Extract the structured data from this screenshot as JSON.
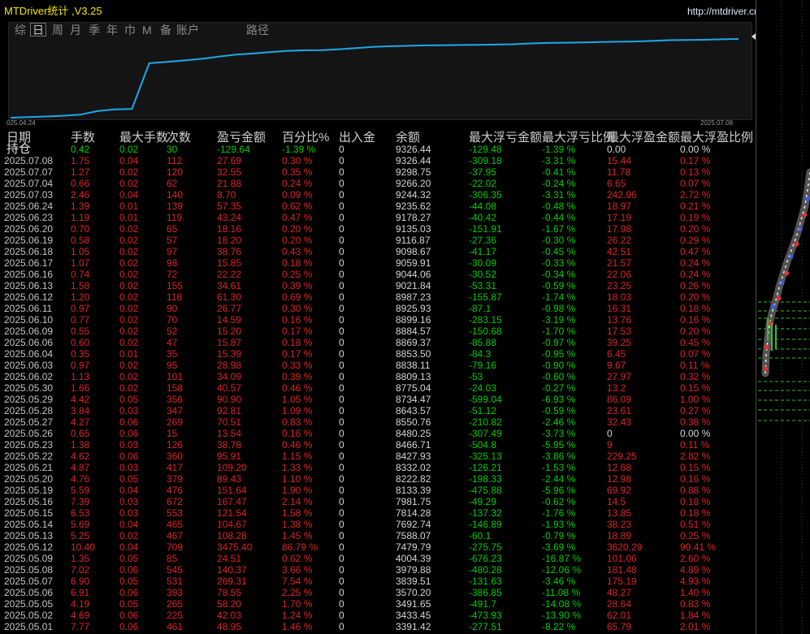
{
  "app": {
    "title": "MTDriver统计 ,V3.25",
    "url": "http://mtdriver.cn"
  },
  "tabs": [
    {
      "label": "综",
      "selected": false
    },
    {
      "label": "日",
      "selected": true
    },
    {
      "label": "周",
      "selected": false
    },
    {
      "label": "月",
      "selected": false
    },
    {
      "label": "季",
      "selected": false
    },
    {
      "label": "年",
      "selected": false
    },
    {
      "label": "巾",
      "selected": false
    },
    {
      "label": "M",
      "selected": false
    },
    {
      "label": "备",
      "selected": false
    },
    {
      "label": "账户",
      "selected": false
    },
    {
      "label": "路径",
      "selected": false
    }
  ],
  "equity_chart": {
    "start_label": "025.04.24",
    "end_label": "2025.07.08"
  },
  "colors": {
    "title": "#f2e600",
    "url": "#e6e6ff",
    "line": "#1fa7e8",
    "up": "#dc2424",
    "down": "#00cc00",
    "neutral": "#d6d6d6",
    "date": "#c6c6c6"
  },
  "table": {
    "headers": [
      "日期",
      "手数",
      "最大手数",
      "次数",
      "盈亏金额",
      "百分比%",
      "出入金",
      "余额",
      "最大浮亏金额",
      "最大浮亏比例",
      "最大浮盈金额",
      "最大浮盈比例"
    ],
    "holding": [
      "持仓",
      "0.42",
      "0.02",
      "30",
      "-129.64",
      "-1.39 %",
      "0",
      "9326.44",
      "-129.48",
      "-1.39 %",
      "0.00",
      "0.00 %"
    ],
    "rows": [
      [
        "2025.07.08",
        "1.75",
        "0.04",
        "112",
        "27.69",
        "0.30 %",
        "0",
        "9326.44",
        "-309.18",
        "-3.31 %",
        "15.44",
        "0.17 %"
      ],
      [
        "2025.07.07",
        "1.27",
        "0.02",
        "120",
        "32.55",
        "0.35 %",
        "0",
        "9298.75",
        "-37.95",
        "-0.41 %",
        "11.78",
        "0.13 %"
      ],
      [
        "2025.07.04",
        "0.66",
        "0.02",
        "62",
        "21.88",
        "0.24 %",
        "0",
        "9266.20",
        "-22.02",
        "-0.24 %",
        "6.65",
        "0.07 %"
      ],
      [
        "2025.07.03",
        "2.46",
        "0.04",
        "140",
        "8.70",
        "0.09 %",
        "0",
        "9244.32",
        "-306.35",
        "-3.31 %",
        "242.96",
        "2.72 %"
      ],
      [
        "2025.06.24",
        "1.39",
        "0.01",
        "139",
        "57.35",
        "0.62 %",
        "0",
        "9235.62",
        "-44.08",
        "-0.48 %",
        "18.97",
        "0.21 %"
      ],
      [
        "2025.06.23",
        "1.19",
        "0.01",
        "119",
        "43.24",
        "0.47 %",
        "0",
        "9178.27",
        "-40.42",
        "-0.44 %",
        "17.19",
        "0.19 %"
      ],
      [
        "2025.06.20",
        "0.70",
        "0.02",
        "65",
        "18.16",
        "0.20 %",
        "0",
        "9135.03",
        "-151.91",
        "-1.67 %",
        "17.98",
        "0.20 %"
      ],
      [
        "2025.06.19",
        "0.58",
        "0.02",
        "57",
        "18.20",
        "0.20 %",
        "0",
        "9116.87",
        "-27.36",
        "-0.30 %",
        "26.22",
        "0.29 %"
      ],
      [
        "2025.06.18",
        "1.05",
        "0.02",
        "97",
        "38.76",
        "0.43 %",
        "0",
        "9098.67",
        "-41.17",
        "-0.45 %",
        "42.51",
        "0.47 %"
      ],
      [
        "2025.06.17",
        "1.07",
        "0.02",
        "98",
        "15.85",
        "0.18 %",
        "0",
        "9059.91",
        "-30.09",
        "-0.33 %",
        "21.57",
        "0.24 %"
      ],
      [
        "2025.06.16",
        "0.74",
        "0.02",
        "72",
        "22.22",
        "0.25 %",
        "0",
        "9044.06",
        "-30.52",
        "-0.34 %",
        "22.06",
        "0.24 %"
      ],
      [
        "2025.06.13",
        "1.58",
        "0.02",
        "155",
        "34.61",
        "0.39 %",
        "0",
        "9021.84",
        "-53.31",
        "-0.59 %",
        "23.25",
        "0.26 %"
      ],
      [
        "2025.06.12",
        "1.20",
        "0.02",
        "118",
        "61.30",
        "0.69 %",
        "0",
        "8987.23",
        "-155.87",
        "-1.74 %",
        "18.03",
        "0.20 %"
      ],
      [
        "2025.06.11",
        "0.97",
        "0.02",
        "90",
        "26.77",
        "0.30 %",
        "0",
        "8925.93",
        "-87.1",
        "-0.98 %",
        "16.31",
        "0.18 %"
      ],
      [
        "2025.06.10",
        "0.77",
        "0.02",
        "70",
        "14.59",
        "0.16 %",
        "0",
        "8899.16",
        "-283.15",
        "-3.19 %",
        "13.76",
        "0.16 %"
      ],
      [
        "2025.06.09",
        "0.55",
        "0.02",
        "52",
        "15.20",
        "0.17 %",
        "0",
        "8884.57",
        "-150.68",
        "-1.70 %",
        "17.53",
        "0.20 %"
      ],
      [
        "2025.06.06",
        "0.60",
        "0.02",
        "47",
        "15.87",
        "0.18 %",
        "0",
        "8869.37",
        "-85.88",
        "-0.97 %",
        "39.25",
        "0.45 %"
      ],
      [
        "2025.06.04",
        "0.35",
        "0.01",
        "35",
        "15.39",
        "0.17 %",
        "0",
        "8853.50",
        "-84.3",
        "-0.95 %",
        "6.45",
        "0.07 %"
      ],
      [
        "2025.06.03",
        "0.97",
        "0.02",
        "95",
        "28.98",
        "0.33 %",
        "0",
        "8838.11",
        "-79.16",
        "-0.90 %",
        "9.67",
        "0.11 %"
      ],
      [
        "2025.06.02",
        "1.13",
        "0.02",
        "101",
        "34.09",
        "0.39 %",
        "0",
        "8809.13",
        "-53",
        "-0.60 %",
        "27.97",
        "0.32 %"
      ],
      [
        "2025.05.30",
        "1.66",
        "0.02",
        "158",
        "40.57",
        "0.46 %",
        "0",
        "8775.04",
        "-24.03",
        "-0.27 %",
        "13.2",
        "0.15 %"
      ],
      [
        "2025.05.29",
        "4.42",
        "0.05",
        "356",
        "90.90",
        "1.05 %",
        "0",
        "8734.47",
        "-599.04",
        "-6.93 %",
        "86.09",
        "1.00 %"
      ],
      [
        "2025.05.28",
        "3.84",
        "0.03",
        "347",
        "92.81",
        "1.09 %",
        "0",
        "8643.57",
        "-51.12",
        "-0.59 %",
        "23.61",
        "0.27 %"
      ],
      [
        "2025.05.27",
        "4.27",
        "0.06",
        "269",
        "70.51",
        "0.83 %",
        "0",
        "8550.76",
        "-210.82",
        "-2.46 %",
        "32.43",
        "0.38 %"
      ],
      [
        "2025.05.26",
        "0.65",
        "0.06",
        "15",
        "13.54",
        "0.16 %",
        "0",
        "8480.25",
        "-307.49",
        "-3.73 %",
        "0",
        "0.00 %"
      ],
      [
        "2025.05.23",
        "1.38",
        "0.03",
        "126",
        "38.78",
        "0.46 %",
        "0",
        "8466.71",
        "-504.8",
        "-5.95 %",
        "9",
        "0.11 %"
      ],
      [
        "2025.05.22",
        "4.62",
        "0.06",
        "360",
        "95.91",
        "1.15 %",
        "0",
        "8427.93",
        "-325.13",
        "-3.86 %",
        "229.25",
        "2.82 %"
      ],
      [
        "2025.05.21",
        "4.87",
        "0.03",
        "417",
        "109.20",
        "1.33 %",
        "0",
        "8332.02",
        "-126.21",
        "-1.53 %",
        "12.68",
        "0.15 %"
      ],
      [
        "2025.05.20",
        "4.76",
        "0.05",
        "379",
        "89.43",
        "1.10 %",
        "0",
        "8222.82",
        "-198.33",
        "-2.44 %",
        "12.98",
        "0.16 %"
      ],
      [
        "2025.05.19",
        "5.59",
        "0.04",
        "476",
        "151.64",
        "1.90 %",
        "0",
        "8133.39",
        "-475.88",
        "-5.96 %",
        "69.92",
        "0.88 %"
      ],
      [
        "2025.05.16",
        "7.39",
        "0.03",
        "672",
        "167.47",
        "2.14 %",
        "0",
        "7981.75",
        "-49.29",
        "-0.62 %",
        "14.5",
        "0.18 %"
      ],
      [
        "2025.05.15",
        "6.53",
        "0.03",
        "553",
        "121.54",
        "1.58 %",
        "0",
        "7814.28",
        "-137.32",
        "-1.76 %",
        "13.85",
        "0.18 %"
      ],
      [
        "2025.05.14",
        "5.69",
        "0.04",
        "465",
        "104.67",
        "1.38 %",
        "0",
        "7692.74",
        "-146.89",
        "-1.93 %",
        "38.23",
        "0.51 %"
      ],
      [
        "2025.05.13",
        "5.25",
        "0.02",
        "467",
        "108.28",
        "1.45 %",
        "0",
        "7588.07",
        "-60.1",
        "-0.79 %",
        "18.89",
        "0.25 %"
      ],
      [
        "2025.05.12",
        "10.40",
        "0.04",
        "709",
        "3475.40",
        "86.79 %",
        "0",
        "7479.79",
        "-275.75",
        "-3.69 %",
        "3620.29",
        "90.41 %"
      ],
      [
        "2025.05.09",
        "1.35",
        "0.05",
        "85",
        "24.51",
        "0.62 %",
        "0",
        "4004.39",
        "-676.23",
        "-16.87 %",
        "101.06",
        "2.60 %"
      ],
      [
        "2025.05.08",
        "7.02",
        "0.06",
        "545",
        "140.37",
        "3.66 %",
        "0",
        "3979.88",
        "-480.28",
        "-12.06 %",
        "181.48",
        "4.89 %"
      ],
      [
        "2025.05.07",
        "6.90",
        "0.05",
        "531",
        "269.31",
        "7.54 %",
        "0",
        "3839.51",
        "-131.63",
        "-3.46 %",
        "175.19",
        "4.93 %"
      ],
      [
        "2025.05.06",
        "6.91",
        "0.06",
        "393",
        "78.55",
        "2.25 %",
        "0",
        "3570.20",
        "-386.85",
        "-11.08 %",
        "48.27",
        "1.40 %"
      ],
      [
        "2025.05.05",
        "4.19",
        "0.05",
        "265",
        "58.20",
        "1.70 %",
        "0",
        "3491.65",
        "-491.7",
        "-14.08 %",
        "28.64",
        "0.83 %"
      ],
      [
        "2025.05.02",
        "4.69",
        "0.06",
        "225",
        "42.03",
        "1.24 %",
        "0",
        "3433.45",
        "-473.93",
        "-13.90 %",
        "62.01",
        "1.84 %"
      ],
      [
        "2025.05.01",
        "7.77",
        "0.06",
        "461",
        "48.95",
        "1.46 %",
        "0",
        "3391.42",
        "-277.51",
        "-8.22 %",
        "65.79",
        "2.01 %"
      ]
    ]
  }
}
